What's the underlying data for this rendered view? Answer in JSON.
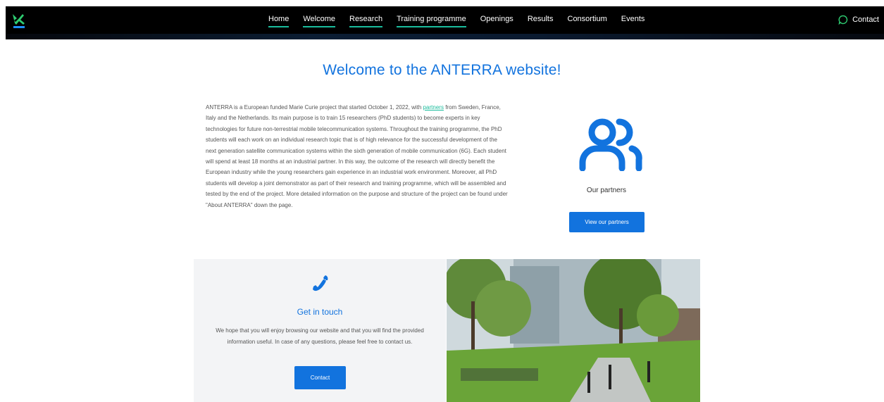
{
  "nav": {
    "items": [
      {
        "label": "Home",
        "active": true
      },
      {
        "label": "Welcome",
        "active": true
      },
      {
        "label": "Research",
        "active": true
      },
      {
        "label": "Training programme",
        "active": true
      },
      {
        "label": "Openings",
        "active": false
      },
      {
        "label": "Results",
        "active": false
      },
      {
        "label": "Consortium",
        "active": false
      },
      {
        "label": "Events",
        "active": false
      }
    ],
    "contact_label": "Contact",
    "contact_icon": "chat-bubble-icon"
  },
  "page": {
    "title": "Welcome to the ANTERRA website!",
    "intro_before_link": "ANTERRA is a European funded Marie Curie project that started October 1, 2022, with ",
    "intro_link": "partners",
    "intro_after_link": " from Sweden, France, Italy and the Netherlands. Its main purpose is to train 15 researchers (PhD students) to become experts in key technologies for future non-terrestrial mobile telecommunication systems. Throughout the training programme, the PhD students will each work on an individual research topic that is of high relevance for the successful development of the next generation satellite communication systems within the sixth generation of mobile communication (6G). Each student will spend at least 18 months at an industrial partner. In this way, the outcome of the research will directly benefit the European industry while the young researchers gain experience in an industrial work environment. Moreover, all PhD students will develop a joint demonstrator as part of their research and training programme, which will be assembled and tested by the end of the project. More detailed information on the purpose and structure of the project can be found under \"About ANTERRA\" down the page."
  },
  "partners": {
    "icon": "users-icon",
    "label": "Our partners",
    "button_label": "View our partners"
  },
  "touch": {
    "icon": "phone-icon",
    "title": "Get in touch",
    "text": "We hope that you will enjoy browsing our website and that you will find the provided information useful. In case of any questions, please feel free to contact us.",
    "button_label": "Contact"
  },
  "colors": {
    "accent": "#1273de",
    "nav_underline": "#1abc9c",
    "logo_green": "#2ecc71",
    "navbar_bg": "#000000"
  }
}
